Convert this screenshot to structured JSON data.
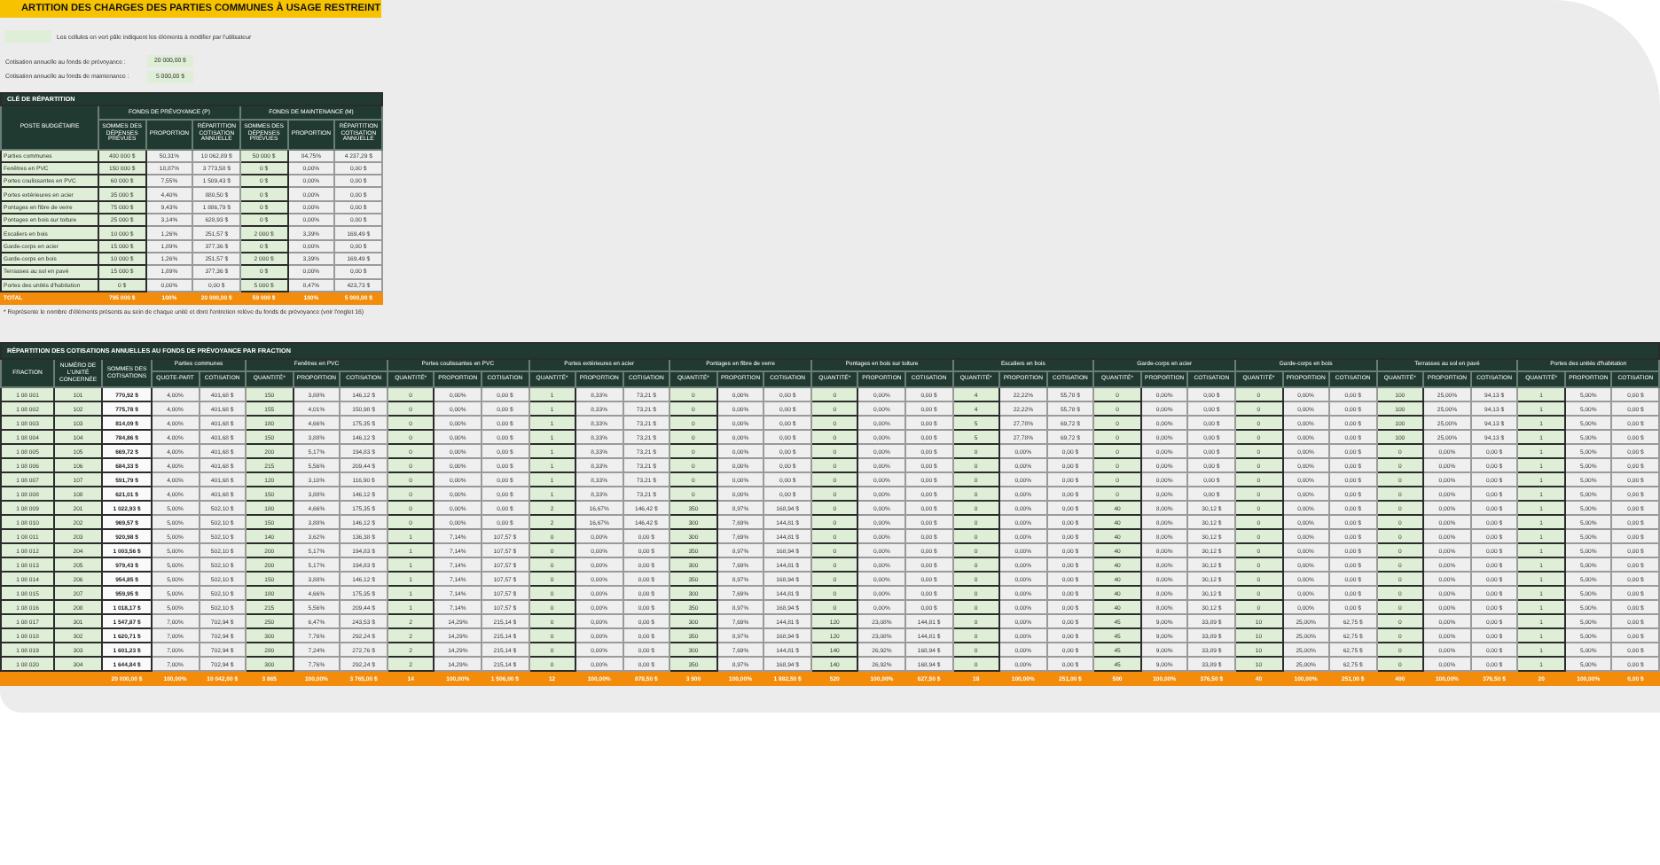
{
  "title": "ARTITION DES CHARGES DES PARTIES COMMUNES À USAGE RESTREINT",
  "legend": "Les cellules en vert pâle indiquent les éléments à modifier par l'utilisateur",
  "contributions": [
    {
      "label": "Cotisation annuelle au fonds de prévoyance :",
      "value": "20 000,00 $"
    },
    {
      "label": "Cotisation annuelle au fonds de maintenance :",
      "value": "5 000,00 $"
    }
  ],
  "key_table": {
    "title": "CLÉ DE RÉPARTITION",
    "first_column": "POSTE BUDGÉTAIRE",
    "groups": [
      {
        "name": "FONDS DE PRÉVOYANCE (P)",
        "columns": [
          {
            "label": "SOMMES DES DÉPENSES PRÉVUES",
            "kind": "input"
          },
          {
            "label": "PROPORTION",
            "kind": "formula"
          },
          {
            "label": "RÉPARTITION COTISATION ANNUELLE",
            "kind": "formula"
          }
        ]
      },
      {
        "name": "FONDS DE MAINTENANCE (M)",
        "columns": [
          {
            "label": "SOMMES DES DÉPENSES PRÉVUES",
            "kind": "input"
          },
          {
            "label": "PROPORTION",
            "kind": "formula"
          },
          {
            "label": "RÉPARTITION COTISATION ANNUELLE",
            "kind": "formula"
          }
        ]
      }
    ],
    "rows": [
      {
        "label": "Parties communes",
        "cells": [
          "400 000 $",
          "50,31%",
          "10 062,89 $",
          "50 000 $",
          "84,75%",
          "4 237,29 $"
        ]
      },
      {
        "label": "Fenêtres en PVC",
        "cells": [
          "150 000 $",
          "18,87%",
          "3 773,58 $",
          "0 $",
          "0,00%",
          "0,00 $"
        ]
      },
      {
        "label": "Portes coulissantes en PVC",
        "cells": [
          "60 000 $",
          "7,55%",
          "1 509,43 $",
          "0 $",
          "0,00%",
          "0,00 $"
        ]
      },
      {
        "label": "Portes extérieures en acier",
        "cells": [
          "35 000 $",
          "4,40%",
          "880,50 $",
          "0 $",
          "0,00%",
          "0,00 $"
        ]
      },
      {
        "label": "Pontages en fibre de verre",
        "cells": [
          "75 000 $",
          "9,43%",
          "1 886,79 $",
          "0 $",
          "0,00%",
          "0,00 $"
        ]
      },
      {
        "label": "Pontages en bois sur toiture",
        "cells": [
          "25 000 $",
          "3,14%",
          "628,93 $",
          "0 $",
          "0,00%",
          "0,00 $"
        ]
      },
      {
        "label": "Escaliers en bois",
        "cells": [
          "10 000 $",
          "1,26%",
          "251,57 $",
          "2 000 $",
          "3,39%",
          "169,49 $"
        ]
      },
      {
        "label": "Garde-corps en acier",
        "cells": [
          "15 000 $",
          "1,89%",
          "377,36 $",
          "0 $",
          "0,00%",
          "0,00 $"
        ]
      },
      {
        "label": "Garde-corps en bois",
        "cells": [
          "10 000 $",
          "1,26%",
          "251,57 $",
          "2 000 $",
          "3,39%",
          "169,49 $"
        ]
      },
      {
        "label": "Terrasses au sol en pavé",
        "cells": [
          "15 000 $",
          "1,89%",
          "377,36 $",
          "0 $",
          "0,00%",
          "0,00 $"
        ]
      },
      {
        "label": "Portes des unités d'habitation",
        "cells": [
          "0 $",
          "0,00%",
          "0,00 $",
          "5 000 $",
          "8,47%",
          "423,73 $"
        ]
      }
    ],
    "total": {
      "label": "TOTAL",
      "cells": [
        "795 000 $",
        "100%",
        "20 000,00 $",
        "59 000 $",
        "100%",
        "5 000,00 $"
      ]
    }
  },
  "footnote": "* Représente le nombre d'éléments présents au sein de chaque unité et dont l'entretien relève du fonds de prévoyance (voir l'onglet 16)",
  "fraction_table": {
    "title": "RÉPARTITION DES COTISATIONS ANNUELLES AU FONDS DE PRÉVOYANCE PAR FRACTION",
    "first_columns": [
      {
        "label": "FRACTION",
        "kind": "input"
      },
      {
        "label": "NUMÉRO DE L'UNITÉ CONCERNÉE",
        "kind": "input"
      },
      {
        "label": "SOMMES DES COTISATIONS",
        "kind": "sum"
      }
    ],
    "groups": [
      {
        "name": "Parties communes",
        "columns": [
          {
            "label": "QUOTE-PART",
            "kind": "formula"
          },
          {
            "label": "COTISATION",
            "kind": "formula"
          }
        ]
      },
      {
        "name": "Fenêtres en PVC",
        "columns": [
          {
            "label": "QUANTITÉ*",
            "kind": "input"
          },
          {
            "label": "PROPORTION",
            "kind": "formula"
          },
          {
            "label": "COTISATION",
            "kind": "formula"
          }
        ]
      },
      {
        "name": "Portes coulissantes en PVC",
        "columns": [
          {
            "label": "QUANTITÉ*",
            "kind": "input"
          },
          {
            "label": "PROPORTION",
            "kind": "formula"
          },
          {
            "label": "COTISATION",
            "kind": "formula"
          }
        ]
      },
      {
        "name": "Portes extérieures en acier",
        "columns": [
          {
            "label": "QUANTITÉ*",
            "kind": "input"
          },
          {
            "label": "PROPORTION",
            "kind": "formula"
          },
          {
            "label": "COTISATION",
            "kind": "formula"
          }
        ]
      },
      {
        "name": "Pontages en fibre de verre",
        "columns": [
          {
            "label": "QUANTITÉ*",
            "kind": "input"
          },
          {
            "label": "PROPORTION",
            "kind": "formula"
          },
          {
            "label": "COTISATION",
            "kind": "formula"
          }
        ]
      },
      {
        "name": "Pontages en bois sur toiture",
        "columns": [
          {
            "label": "QUANTITÉ*",
            "kind": "input"
          },
          {
            "label": "PROPORTION",
            "kind": "formula"
          },
          {
            "label": "COTISATION",
            "kind": "formula"
          }
        ]
      },
      {
        "name": "Escaliers en bois",
        "columns": [
          {
            "label": "QUANTITÉ*",
            "kind": "input"
          },
          {
            "label": "PROPORTION",
            "kind": "formula"
          },
          {
            "label": "COTISATION",
            "kind": "formula"
          }
        ]
      },
      {
        "name": "Garde-corps en acier",
        "columns": [
          {
            "label": "QUANTITÉ*",
            "kind": "input"
          },
          {
            "label": "PROPORTION",
            "kind": "formula"
          },
          {
            "label": "COTISATION",
            "kind": "formula"
          }
        ]
      },
      {
        "name": "Garde-corps en bois",
        "columns": [
          {
            "label": "QUANTITÉ*",
            "kind": "input"
          },
          {
            "label": "PROPORTION",
            "kind": "formula"
          },
          {
            "label": "COTISATION",
            "kind": "formula"
          }
        ]
      },
      {
        "name": "Terrasses au sol en pavé",
        "columns": [
          {
            "label": "QUANTITÉ*",
            "kind": "input"
          },
          {
            "label": "PROPORTION",
            "kind": "formula"
          },
          {
            "label": "COTISATION",
            "kind": "formula"
          }
        ]
      },
      {
        "name": "Portes des unités d'habitation",
        "columns": [
          {
            "label": "QUANTITÉ*",
            "kind": "input"
          },
          {
            "label": "PROPORTION",
            "kind": "formula"
          },
          {
            "label": "COTISATION",
            "kind": "formula"
          }
        ]
      }
    ],
    "rows": [
      [
        "1 08 001",
        "101",
        "770,92 $",
        "4,00%",
        "401,68 $",
        "150",
        "3,88%",
        "146,12 $",
        "0",
        "0,00%",
        "0,00 $",
        "1",
        "8,33%",
        "73,21 $",
        "0",
        "0,00%",
        "0,00 $",
        "0",
        "0,00%",
        "0,00 $",
        "4",
        "22,22%",
        "55,78 $",
        "0",
        "0,00%",
        "0,00 $",
        "0",
        "0,00%",
        "0,00 $",
        "100",
        "25,00%",
        "94,13 $",
        "1",
        "5,00%",
        "0,00 $"
      ],
      [
        "1 08 002",
        "102",
        "775,78 $",
        "4,00%",
        "401,68 $",
        "155",
        "4,01%",
        "150,98 $",
        "0",
        "0,00%",
        "0,00 $",
        "1",
        "8,33%",
        "73,21 $",
        "0",
        "0,00%",
        "0,00 $",
        "0",
        "0,00%",
        "0,00 $",
        "4",
        "22,22%",
        "55,78 $",
        "0",
        "0,00%",
        "0,00 $",
        "0",
        "0,00%",
        "0,00 $",
        "100",
        "25,00%",
        "94,13 $",
        "1",
        "5,00%",
        "0,00 $"
      ],
      [
        "1 08 003",
        "103",
        "814,09 $",
        "4,00%",
        "401,68 $",
        "180",
        "4,66%",
        "175,35 $",
        "0",
        "0,00%",
        "0,00 $",
        "1",
        "8,33%",
        "73,21 $",
        "0",
        "0,00%",
        "0,00 $",
        "0",
        "0,00%",
        "0,00 $",
        "5",
        "27,78%",
        "69,72 $",
        "0",
        "0,00%",
        "0,00 $",
        "0",
        "0,00%",
        "0,00 $",
        "100",
        "25,00%",
        "94,13 $",
        "1",
        "5,00%",
        "0,00 $"
      ],
      [
        "1 08 004",
        "104",
        "784,86 $",
        "4,00%",
        "401,68 $",
        "150",
        "3,88%",
        "146,12 $",
        "0",
        "0,00%",
        "0,00 $",
        "1",
        "8,33%",
        "73,21 $",
        "0",
        "0,00%",
        "0,00 $",
        "0",
        "0,00%",
        "0,00 $",
        "5",
        "27,78%",
        "69,72 $",
        "0",
        "0,00%",
        "0,00 $",
        "0",
        "0,00%",
        "0,00 $",
        "100",
        "25,00%",
        "94,13 $",
        "1",
        "5,00%",
        "0,00 $"
      ],
      [
        "1 08 005",
        "105",
        "669,72 $",
        "4,00%",
        "401,68 $",
        "200",
        "5,17%",
        "194,83 $",
        "0",
        "0,00%",
        "0,00 $",
        "1",
        "8,33%",
        "73,21 $",
        "0",
        "0,00%",
        "0,00 $",
        "0",
        "0,00%",
        "0,00 $",
        "0",
        "0,00%",
        "0,00 $",
        "0",
        "0,00%",
        "0,00 $",
        "0",
        "0,00%",
        "0,00 $",
        "0",
        "0,00%",
        "0,00 $",
        "1",
        "5,00%",
        "0,00 $"
      ],
      [
        "1 08 006",
        "106",
        "684,33 $",
        "4,00%",
        "401,68 $",
        "215",
        "5,56%",
        "209,44 $",
        "0",
        "0,00%",
        "0,00 $",
        "1",
        "8,33%",
        "73,21 $",
        "0",
        "0,00%",
        "0,00 $",
        "0",
        "0,00%",
        "0,00 $",
        "0",
        "0,00%",
        "0,00 $",
        "0",
        "0,00%",
        "0,00 $",
        "0",
        "0,00%",
        "0,00 $",
        "0",
        "0,00%",
        "0,00 $",
        "1",
        "5,00%",
        "0,00 $"
      ],
      [
        "1 08 007",
        "107",
        "591,79 $",
        "4,00%",
        "401,68 $",
        "120",
        "3,10%",
        "116,90 $",
        "0",
        "0,00%",
        "0,00 $",
        "1",
        "8,33%",
        "73,21 $",
        "0",
        "0,00%",
        "0,00 $",
        "0",
        "0,00%",
        "0,00 $",
        "0",
        "0,00%",
        "0,00 $",
        "0",
        "0,00%",
        "0,00 $",
        "0",
        "0,00%",
        "0,00 $",
        "0",
        "0,00%",
        "0,00 $",
        "1",
        "5,00%",
        "0,00 $"
      ],
      [
        "1 08 008",
        "108",
        "621,01 $",
        "4,00%",
        "401,68 $",
        "150",
        "3,88%",
        "146,12 $",
        "0",
        "0,00%",
        "0,00 $",
        "1",
        "8,33%",
        "73,21 $",
        "0",
        "0,00%",
        "0,00 $",
        "0",
        "0,00%",
        "0,00 $",
        "0",
        "0,00%",
        "0,00 $",
        "0",
        "0,00%",
        "0,00 $",
        "0",
        "0,00%",
        "0,00 $",
        "0",
        "0,00%",
        "0,00 $",
        "1",
        "5,00%",
        "0,00 $"
      ],
      [
        "1 08 009",
        "201",
        "1 022,93 $",
        "5,00%",
        "502,10 $",
        "180",
        "4,66%",
        "175,35 $",
        "0",
        "0,00%",
        "0,00 $",
        "2",
        "16,67%",
        "146,42 $",
        "350",
        "8,97%",
        "168,94 $",
        "0",
        "0,00%",
        "0,00 $",
        "0",
        "0,00%",
        "0,00 $",
        "40",
        "8,00%",
        "30,12 $",
        "0",
        "0,00%",
        "0,00 $",
        "0",
        "0,00%",
        "0,00 $",
        "1",
        "5,00%",
        "0,00 $"
      ],
      [
        "1 08 010",
        "202",
        "969,57 $",
        "5,00%",
        "502,10 $",
        "150",
        "3,88%",
        "146,12 $",
        "0",
        "0,00%",
        "0,00 $",
        "2",
        "16,67%",
        "146,42 $",
        "300",
        "7,69%",
        "144,81 $",
        "0",
        "0,00%",
        "0,00 $",
        "0",
        "0,00%",
        "0,00 $",
        "40",
        "8,00%",
        "30,12 $",
        "0",
        "0,00%",
        "0,00 $",
        "0",
        "0,00%",
        "0,00 $",
        "1",
        "5,00%",
        "0,00 $"
      ],
      [
        "1 08 011",
        "203",
        "920,98 $",
        "5,00%",
        "502,10 $",
        "140",
        "3,62%",
        "136,38 $",
        "1",
        "7,14%",
        "107,57 $",
        "0",
        "0,00%",
        "0,00 $",
        "300",
        "7,69%",
        "144,81 $",
        "0",
        "0,00%",
        "0,00 $",
        "0",
        "0,00%",
        "0,00 $",
        "40",
        "8,00%",
        "30,12 $",
        "0",
        "0,00%",
        "0,00 $",
        "0",
        "0,00%",
        "0,00 $",
        "1",
        "5,00%",
        "0,00 $"
      ],
      [
        "1 08 012",
        "204",
        "1 003,56 $",
        "5,00%",
        "502,10 $",
        "200",
        "5,17%",
        "194,83 $",
        "1",
        "7,14%",
        "107,57 $",
        "0",
        "0,00%",
        "0,00 $",
        "350",
        "8,97%",
        "168,94 $",
        "0",
        "0,00%",
        "0,00 $",
        "0",
        "0,00%",
        "0,00 $",
        "40",
        "8,00%",
        "30,12 $",
        "0",
        "0,00%",
        "0,00 $",
        "0",
        "0,00%",
        "0,00 $",
        "1",
        "5,00%",
        "0,00 $"
      ],
      [
        "1 08 013",
        "205",
        "979,43 $",
        "5,00%",
        "502,10 $",
        "200",
        "5,17%",
        "194,83 $",
        "1",
        "7,14%",
        "107,57 $",
        "0",
        "0,00%",
        "0,00 $",
        "300",
        "7,69%",
        "144,81 $",
        "0",
        "0,00%",
        "0,00 $",
        "0",
        "0,00%",
        "0,00 $",
        "40",
        "8,00%",
        "30,12 $",
        "0",
        "0,00%",
        "0,00 $",
        "0",
        "0,00%",
        "0,00 $",
        "1",
        "5,00%",
        "0,00 $"
      ],
      [
        "1 08 014",
        "206",
        "954,85 $",
        "5,00%",
        "502,10 $",
        "150",
        "3,88%",
        "146,12 $",
        "1",
        "7,14%",
        "107,57 $",
        "0",
        "0,00%",
        "0,00 $",
        "350",
        "8,97%",
        "168,94 $",
        "0",
        "0,00%",
        "0,00 $",
        "0",
        "0,00%",
        "0,00 $",
        "40",
        "8,00%",
        "30,12 $",
        "0",
        "0,00%",
        "0,00 $",
        "0",
        "0,00%",
        "0,00 $",
        "1",
        "5,00%",
        "0,00 $"
      ],
      [
        "1 08 015",
        "207",
        "959,95 $",
        "5,00%",
        "502,10 $",
        "180",
        "4,66%",
        "175,35 $",
        "1",
        "7,14%",
        "107,57 $",
        "0",
        "0,00%",
        "0,00 $",
        "300",
        "7,69%",
        "144,81 $",
        "0",
        "0,00%",
        "0,00 $",
        "0",
        "0,00%",
        "0,00 $",
        "40",
        "8,00%",
        "30,12 $",
        "0",
        "0,00%",
        "0,00 $",
        "0",
        "0,00%",
        "0,00 $",
        "1",
        "5,00%",
        "0,00 $"
      ],
      [
        "1 08 016",
        "208",
        "1 018,17 $",
        "5,00%",
        "502,10 $",
        "215",
        "5,56%",
        "209,44 $",
        "1",
        "7,14%",
        "107,57 $",
        "0",
        "0,00%",
        "0,00 $",
        "350",
        "8,97%",
        "168,94 $",
        "0",
        "0,00%",
        "0,00 $",
        "0",
        "0,00%",
        "0,00 $",
        "40",
        "8,00%",
        "30,12 $",
        "0",
        "0,00%",
        "0,00 $",
        "0",
        "0,00%",
        "0,00 $",
        "1",
        "5,00%",
        "0,00 $"
      ],
      [
        "1 08 017",
        "301",
        "1 547,87 $",
        "7,00%",
        "702,94 $",
        "250",
        "6,47%",
        "243,53 $",
        "2",
        "14,29%",
        "215,14 $",
        "0",
        "0,00%",
        "0,00 $",
        "300",
        "7,69%",
        "144,81 $",
        "120",
        "23,08%",
        "144,81 $",
        "0",
        "0,00%",
        "0,00 $",
        "45",
        "9,00%",
        "33,89 $",
        "10",
        "25,00%",
        "62,75 $",
        "0",
        "0,00%",
        "0,00 $",
        "1",
        "5,00%",
        "0,00 $"
      ],
      [
        "1 08 018",
        "302",
        "1 620,71 $",
        "7,00%",
        "702,94 $",
        "300",
        "7,76%",
        "292,24 $",
        "2",
        "14,29%",
        "215,14 $",
        "0",
        "0,00%",
        "0,00 $",
        "350",
        "8,97%",
        "168,94 $",
        "120",
        "23,08%",
        "144,81 $",
        "0",
        "0,00%",
        "0,00 $",
        "45",
        "9,00%",
        "33,89 $",
        "10",
        "25,00%",
        "62,75 $",
        "0",
        "0,00%",
        "0,00 $",
        "1",
        "5,00%",
        "0,00 $"
      ],
      [
        "1 08 019",
        "303",
        "1 601,23 $",
        "7,00%",
        "702,94 $",
        "280",
        "7,24%",
        "272,76 $",
        "2",
        "14,29%",
        "215,14 $",
        "0",
        "0,00%",
        "0,00 $",
        "300",
        "7,69%",
        "144,81 $",
        "140",
        "26,92%",
        "168,94 $",
        "0",
        "0,00%",
        "0,00 $",
        "45",
        "9,00%",
        "33,89 $",
        "10",
        "25,00%",
        "62,75 $",
        "0",
        "0,00%",
        "0,00 $",
        "1",
        "5,00%",
        "0,00 $"
      ],
      [
        "1 08 020",
        "304",
        "1 644,84 $",
        "7,00%",
        "702,94 $",
        "300",
        "7,76%",
        "292,24 $",
        "2",
        "14,29%",
        "215,14 $",
        "0",
        "0,00%",
        "0,00 $",
        "350",
        "8,97%",
        "168,94 $",
        "140",
        "26,92%",
        "168,94 $",
        "0",
        "0,00%",
        "0,00 $",
        "45",
        "9,00%",
        "33,89 $",
        "10",
        "25,00%",
        "62,75 $",
        "0",
        "0,00%",
        "0,00 $",
        "1",
        "5,00%",
        "0,00 $"
      ]
    ],
    "total": [
      "20 000,00 $",
      "100,00%",
      "10 042,00 $",
      "3 865",
      "100,00%",
      "3 765,00 $",
      "14",
      "100,00%",
      "1 506,00 $",
      "12",
      "100,00%",
      "878,50 $",
      "3 900",
      "100,00%",
      "1 882,50 $",
      "520",
      "100,00%",
      "627,50 $",
      "18",
      "100,00%",
      "251,00 $",
      "500",
      "100,00%",
      "376,50 $",
      "40",
      "100,00%",
      "251,00 $",
      "400",
      "100,00%",
      "376,50 $",
      "20",
      "100,00%",
      "0,00 $"
    ]
  }
}
